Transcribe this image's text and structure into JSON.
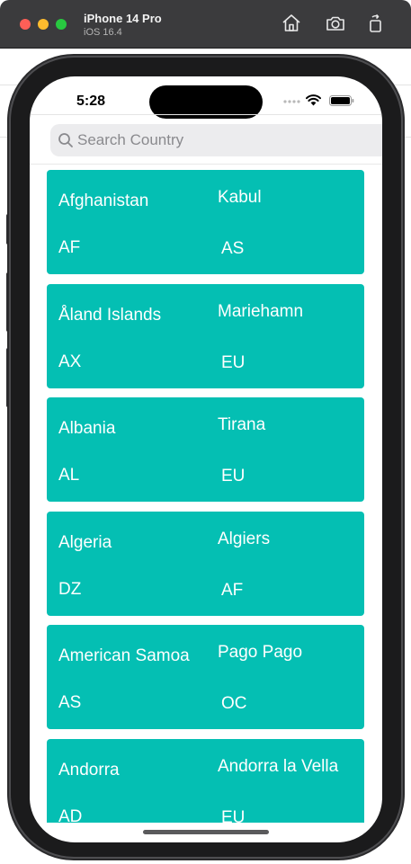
{
  "simulator": {
    "device_name": "iPhone 14 Pro",
    "os_version": "iOS 16.4",
    "toolbar": {
      "home_icon": "home-icon",
      "screenshot_icon": "camera-icon",
      "rotate_icon": "rotate-icon"
    }
  },
  "status_bar": {
    "time": "5:28"
  },
  "search": {
    "placeholder": "Search Country",
    "value": ""
  },
  "colors": {
    "card": "#04bfb3",
    "card_text": "#ffffff"
  },
  "countries": [
    {
      "name": "Afghanistan",
      "capital": "Kabul",
      "code": "AF",
      "region": "AS"
    },
    {
      "name": "Åland Islands",
      "capital": "Mariehamn",
      "code": "AX",
      "region": "EU"
    },
    {
      "name": "Albania",
      "capital": "Tirana",
      "code": "AL",
      "region": "EU"
    },
    {
      "name": "Algeria",
      "capital": "Algiers",
      "code": "DZ",
      "region": "AF"
    },
    {
      "name": "American Samoa",
      "capital": "Pago Pago",
      "code": "AS",
      "region": "OC"
    },
    {
      "name": "Andorra",
      "capital": "Andorra la Vella",
      "code": "AD",
      "region": "EU"
    }
  ]
}
